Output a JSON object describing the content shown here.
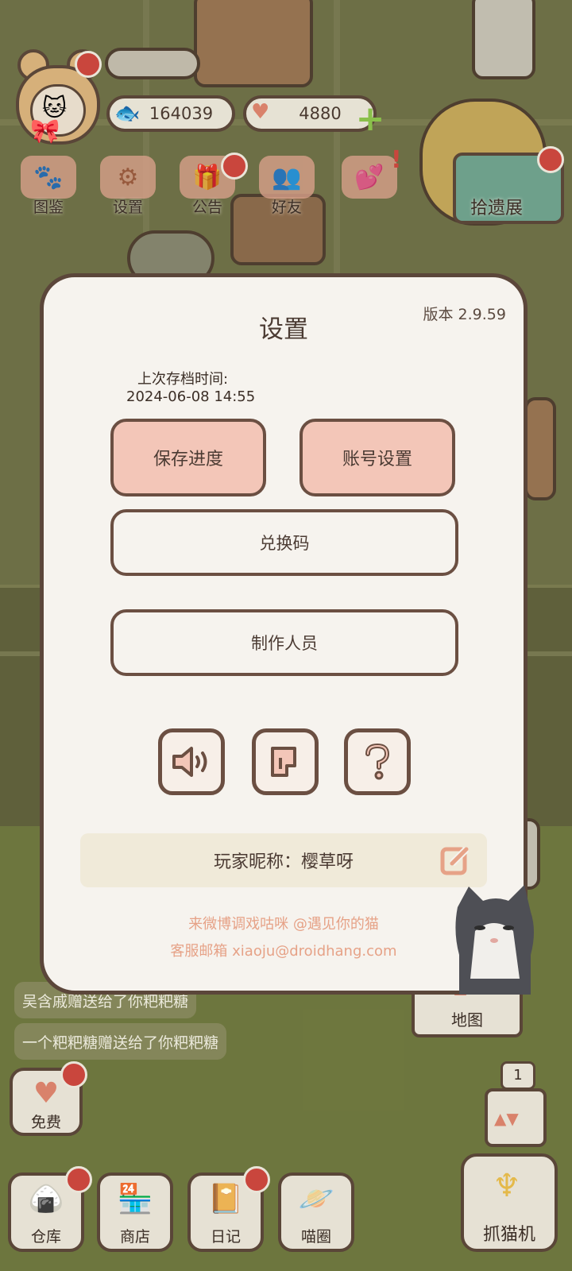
{
  "hud": {
    "fish_count": "164039",
    "heart_count": "4880"
  },
  "top_menu": [
    {
      "label": "图鉴",
      "icon": "cat-face-icon"
    },
    {
      "label": "设置",
      "icon": "gear-icon"
    },
    {
      "label": "公告",
      "icon": "gift-icon"
    },
    {
      "label": "好友",
      "icon": "friends-icon"
    },
    {
      "label": "",
      "icon": "heart-mail-icon"
    }
  ],
  "exhibit": {
    "label": "拾遗展"
  },
  "dialog": {
    "title": "设置",
    "version": "版本 2.9.59",
    "last_save_label": "上次存档时间:",
    "last_save_time": "2024-06-08 14:55",
    "save_button": "保存进度",
    "account_button": "账号设置",
    "redeem_button": "兑换码",
    "credits_button": "制作人员",
    "icon_buttons": [
      "sound-icon",
      "music-icon",
      "help-icon"
    ],
    "nickname": "玩家昵称：樱草呀",
    "weibo_line": "来微博调戏咕咪 @遇见你的猫",
    "email_line": "客服邮箱 xiaoju@droidhang.com"
  },
  "chat": [
    "吴含戚赠送给了你粑粑糖",
    "一个粑粑糖赠送给了你粑粑糖"
  ],
  "map": {
    "label": "地图"
  },
  "free": {
    "label": "免费"
  },
  "bottom_bar": [
    {
      "label": "仓库",
      "icon": "storage-icon"
    },
    {
      "label": "商店",
      "icon": "shop-icon"
    },
    {
      "label": "日记",
      "icon": "diary-icon"
    },
    {
      "label": "喵圈",
      "icon": "cat-planet-icon"
    }
  ],
  "claw_machine": {
    "label": "抓猫机",
    "count": "1"
  },
  "colors": {
    "dialog_bg": "#f6f3ee",
    "dialog_border": "#5b463a",
    "pink_button": "#f3c6b8",
    "footer_text": "#e6a287",
    "badge_red": "#c9463d"
  }
}
